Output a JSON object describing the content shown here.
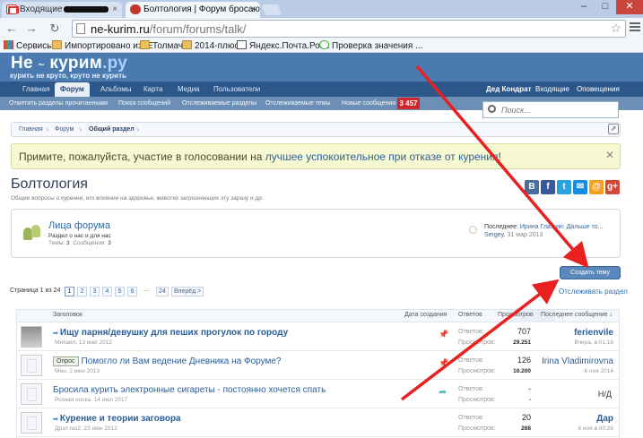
{
  "browser": {
    "tabs": [
      {
        "label": "Входящие"
      },
      {
        "label": "Болтология | Форум бросаю"
      }
    ],
    "url_host": "ne-kurim.ru",
    "url_path": "/forum/forums/talk/",
    "window_controls": {
      "minimize": "–",
      "maximize": "□",
      "close": "✕"
    },
    "bookmarks": [
      {
        "label": "Сервисы",
        "icon": "apps-icon"
      },
      {
        "label": "Импортировано из IE",
        "icon": "folder-icon"
      },
      {
        "label": "Толмач",
        "icon": "folder-icon"
      },
      {
        "label": "2014-плюс",
        "icon": "folder-icon"
      },
      {
        "label": "Яндекс.Почта.Роза",
        "icon": "mail-icon"
      },
      {
        "label": "Проверка значения ...",
        "icon": "globe-icon"
      }
    ]
  },
  "site": {
    "logo_main": "Не",
    "logo_word": "курим",
    "logo_tld": ".ру",
    "slogan": "курить не круто, круто не курить",
    "nav": [
      {
        "label": "Главная"
      },
      {
        "label": "Форум",
        "active": true
      },
      {
        "label": "Альбомы"
      },
      {
        "label": "Карта"
      },
      {
        "label": "Медиа"
      },
      {
        "label": "Пользователи"
      }
    ],
    "user": {
      "name": "Дед Кондрат",
      "inbox": "Входящие",
      "alerts": "Оповещения"
    },
    "subnav": [
      {
        "label": "Отметить разделы прочитанными"
      },
      {
        "label": "Поиск сообщений"
      },
      {
        "label": "Отслеживаемые разделы"
      },
      {
        "label": "Отслеживаемые темы"
      },
      {
        "label": "Новые сообщения"
      }
    ],
    "new_count": "3 457",
    "search_placeholder": "Поиск..."
  },
  "breadcrumb": [
    "Главная",
    "Форум",
    "Общий раздел"
  ],
  "notice": {
    "before": "Примите, пожалуйста, участие в голосовании на ",
    "link": "лучшее успокоительное при отказе от курения",
    "after": "!",
    "close": "✕"
  },
  "forum": {
    "title": "Болтология",
    "description": "Общие вопросы о курении, его влиянии на здоровье, животях загрязняющих эту заразу и др.",
    "share_buttons": [
      {
        "label": "В",
        "color": "#4a6f9c"
      },
      {
        "label": "f",
        "color": "#3b5998"
      },
      {
        "label": "t",
        "color": "#29a3e0"
      },
      {
        "label": "✉",
        "color": "#168de2"
      },
      {
        "label": "@",
        "color": "#f59f1a"
      },
      {
        "label": "g+",
        "color": "#d34836"
      }
    ]
  },
  "subforum": {
    "name": "Лица форума",
    "description": "Раздел о нас и для нас",
    "stats_threads_label": "Темы:",
    "stats_threads": "3",
    "stats_posts_label": "Сообщения:",
    "stats_posts": "3",
    "last_label": "Последнее:",
    "last_title": "Ирина Глазкин: Дальше то...",
    "last_user": "Sergey",
    "last_date": "31 мар 2013"
  },
  "actions": {
    "create_thread": "Создать тему",
    "follow_forum": "Отслеживать раздел"
  },
  "pagination": {
    "label": "Страница 1 из 24",
    "pages": [
      "1",
      "2",
      "3",
      "4",
      "5",
      "6"
    ],
    "gap": "...",
    "last": "24",
    "next": "Вперёд >"
  },
  "table": {
    "headers": {
      "title": "Заголовок",
      "created": "Дата создания",
      "replies": "Ответов",
      "views": "Просмотров",
      "last": "Последнее сообщение ↓"
    },
    "rows": [
      {
        "title": "Ищу парня/девушку для пеших прогулок по городу",
        "meta": "Михаил, 13 май 2012",
        "replies_label": "Ответов:",
        "replies": "707",
        "views_label": "Просмотров:",
        "views": "29.251",
        "last_user": "ferienvile",
        "last_date": "Вчера, в 01:18",
        "sticky": true,
        "avatar": "photo"
      },
      {
        "prefix": "Опрос",
        "title": "Помогло ли Вам ведение Дневника на Форуме?",
        "meta": "Мен, 2 июн 2013",
        "replies_label": "Ответов:",
        "replies": "126",
        "views_label": "Просмотров:",
        "views": "10.200",
        "last_user": "Irina Vladimirovna",
        "last_date": "6 ноя 2014",
        "sticky": true,
        "avatar": "blank"
      },
      {
        "title": "Бросила курить электронные сигареты - постоянно хочется спать",
        "meta": "Розная носка, 14 июл 2017",
        "replies_label": "Ответов:",
        "replies": "-",
        "views_label": "Просмотров:",
        "views": "-",
        "last_user": "Н/Д",
        "last_date": "",
        "moved": true,
        "avatar": "blank"
      },
      {
        "title": "Курение и теории заговора",
        "meta": "Дрзл газ2, 23 июн 2012",
        "replies_label": "Ответов:",
        "replies": "20",
        "views_label": "Просмотров:",
        "views": "268",
        "last_user": "Дар",
        "last_date": "6 ноя в 00:28",
        "avatar": "blank"
      }
    ]
  },
  "annotation_color": "#e8201f"
}
